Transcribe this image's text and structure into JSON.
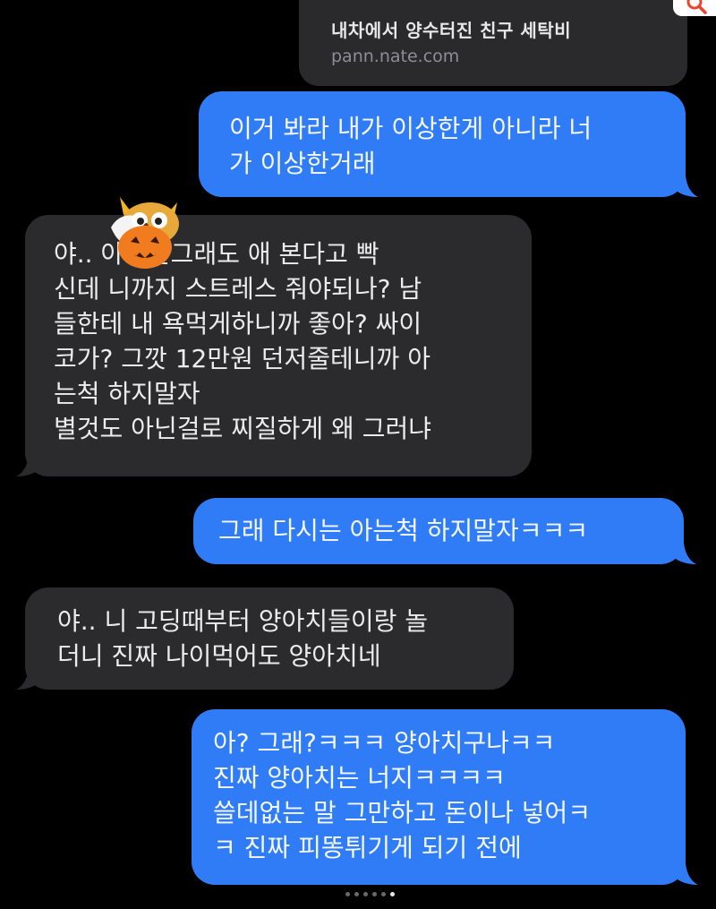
{
  "link_preview": {
    "title": "내차에서 양수터진 친구 세탁비",
    "url": "pann.nate.com"
  },
  "messages": [
    {
      "direction": "outgoing",
      "text": "이거 봐라 내가 이상한게 아니라 너\n가 이상한거래"
    },
    {
      "direction": "incoming",
      "text": "야..      아.. 안그래도 애 본다고 빡\n신데 니까지 스트레스 줘야되나? 남\n들한테 내 욕먹게하니까 좋아? 싸이\n코가? 그깟 12만원 던저줄테니까 아\n는척 하지말자\n별것도 아닌걸로 찌질하게 왜 그러냐"
    },
    {
      "direction": "outgoing",
      "text": "그래 다시는 아는척 하지말자ㅋㅋㅋ"
    },
    {
      "direction": "incoming",
      "text": "야.. 니 고딩때부터 양아치들이랑 놀\n더니 진짜 나이먹어도 양아치네"
    },
    {
      "direction": "outgoing",
      "text": "아? 그래?ㅋㅋㅋ 양아치구나ㅋㅋ\n진짜 양아치는 너지ㅋㅋㅋㅋ\n쓸데없는 말 그만하고 돈이나 넣어ㅋ\nㅋ 진짜 피똥튀기게 되기 전에"
    }
  ],
  "icons": {
    "search": "search-icon",
    "sticker": "pumpkin-monster-sticker-icon"
  },
  "colors": {
    "outgoing_bubble": "#2f7cf6",
    "incoming_bubble": "#2b2b2d",
    "background": "#000000",
    "search_accent": "#e8452c"
  },
  "pagination": {
    "total": 6,
    "active_index": 5
  }
}
